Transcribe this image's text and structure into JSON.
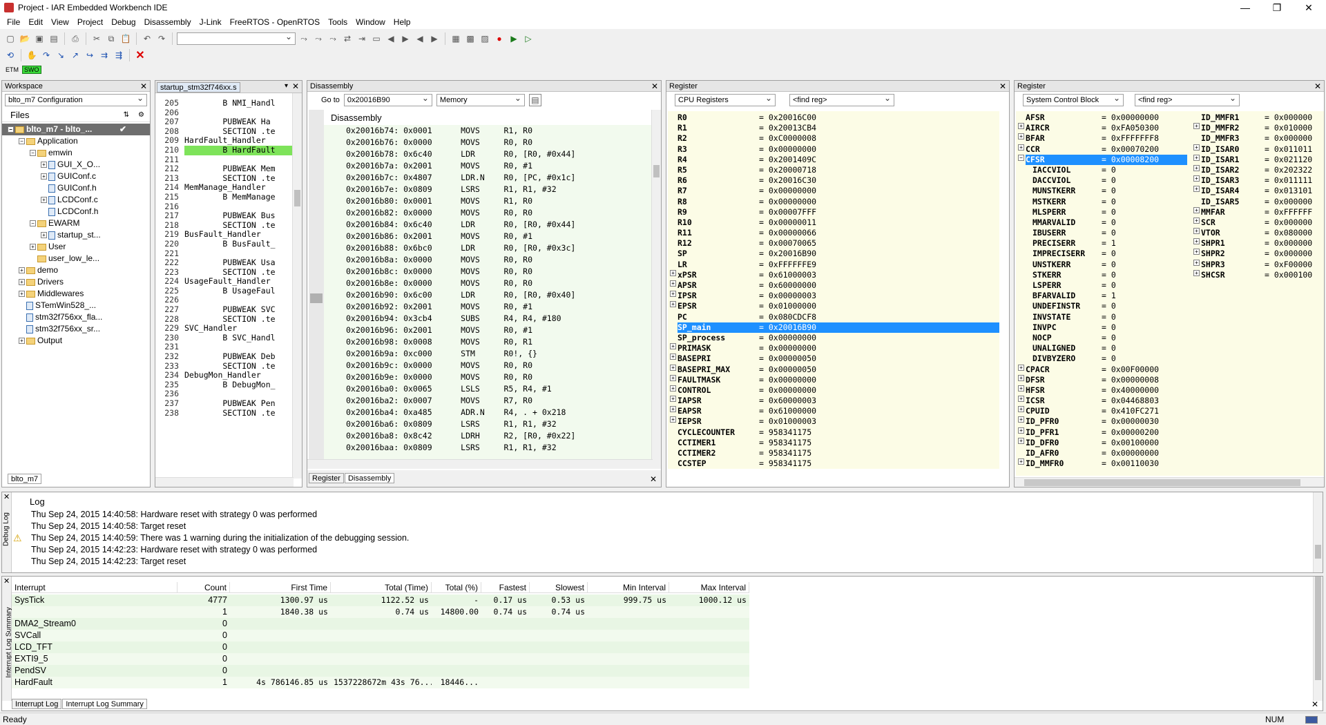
{
  "window": {
    "title": "Project - IAR Embedded Workbench IDE",
    "min": "—",
    "max": "❐",
    "close": "✕"
  },
  "menu": [
    "File",
    "Edit",
    "View",
    "Project",
    "Debug",
    "Disassembly",
    "J-Link",
    "FreeRTOS - OpenRTOS",
    "Tools",
    "Window",
    "Help"
  ],
  "toolbar3": {
    "etm": "ETM",
    "swo": "SWO"
  },
  "workspace": {
    "title": "Workspace",
    "config": "blto_m7 Configuration",
    "files_label": "Files",
    "tab": "blto_m7",
    "tree": [
      {
        "label": "blto_m7 - blto_...",
        "indent": 0,
        "type": "project",
        "exp": "−",
        "selected": true
      },
      {
        "label": "Application",
        "indent": 1,
        "type": "folder",
        "exp": "−"
      },
      {
        "label": "emwin",
        "indent": 2,
        "type": "folder",
        "exp": "−"
      },
      {
        "label": "GUI_X_O...",
        "indent": 3,
        "type": "file",
        "exp": "+"
      },
      {
        "label": "GUIConf.c",
        "indent": 3,
        "type": "file",
        "exp": "+"
      },
      {
        "label": "GUIConf.h",
        "indent": 3,
        "type": "file",
        "exp": ""
      },
      {
        "label": "LCDConf.c",
        "indent": 3,
        "type": "file",
        "exp": "+"
      },
      {
        "label": "LCDConf.h",
        "indent": 3,
        "type": "file",
        "exp": ""
      },
      {
        "label": "EWARM",
        "indent": 2,
        "type": "folder",
        "exp": "−"
      },
      {
        "label": "startup_st...",
        "indent": 3,
        "type": "file",
        "exp": "+"
      },
      {
        "label": "User",
        "indent": 2,
        "type": "folder",
        "exp": "+"
      },
      {
        "label": "user_low_le...",
        "indent": 2,
        "type": "folder",
        "exp": ""
      },
      {
        "label": "demo",
        "indent": 1,
        "type": "folder",
        "exp": "+"
      },
      {
        "label": "Drivers",
        "indent": 1,
        "type": "folder",
        "exp": "+"
      },
      {
        "label": "Middlewares",
        "indent": 1,
        "type": "folder",
        "exp": "+"
      },
      {
        "label": "STemWin528_...",
        "indent": 1,
        "type": "file",
        "exp": ""
      },
      {
        "label": "stm32f756xx_fla...",
        "indent": 1,
        "type": "file",
        "exp": ""
      },
      {
        "label": "stm32f756xx_sr...",
        "indent": 1,
        "type": "file",
        "exp": ""
      },
      {
        "label": "Output",
        "indent": 1,
        "type": "folder",
        "exp": "+"
      }
    ]
  },
  "editor": {
    "tab": "startup_stm32f746xx.s",
    "lines": [
      {
        "n": "205",
        "t": "        B NMI_Handl"
      },
      {
        "n": "206",
        "t": ""
      },
      {
        "n": "207",
        "t": "        PUBWEAK Ha"
      },
      {
        "n": "208",
        "t": "        SECTION .te"
      },
      {
        "n": "209",
        "t": "HardFault_Handler"
      },
      {
        "n": "210",
        "t": "        B HardFault",
        "hl": true
      },
      {
        "n": "211",
        "t": ""
      },
      {
        "n": "212",
        "t": "        PUBWEAK Mem"
      },
      {
        "n": "213",
        "t": "        SECTION .te"
      },
      {
        "n": "214",
        "t": "MemManage_Handler"
      },
      {
        "n": "215",
        "t": "        B MemManage"
      },
      {
        "n": "216",
        "t": ""
      },
      {
        "n": "217",
        "t": "        PUBWEAK Bus"
      },
      {
        "n": "218",
        "t": "        SECTION .te"
      },
      {
        "n": "219",
        "t": "BusFault_Handler"
      },
      {
        "n": "220",
        "t": "        B BusFault_"
      },
      {
        "n": "221",
        "t": ""
      },
      {
        "n": "222",
        "t": "        PUBWEAK Usa"
      },
      {
        "n": "223",
        "t": "        SECTION .te"
      },
      {
        "n": "224",
        "t": "UsageFault_Handler"
      },
      {
        "n": "225",
        "t": "        B UsageFaul"
      },
      {
        "n": "226",
        "t": ""
      },
      {
        "n": "227",
        "t": "        PUBWEAK SVC"
      },
      {
        "n": "228",
        "t": "        SECTION .te"
      },
      {
        "n": "229",
        "t": "SVC_Handler"
      },
      {
        "n": "230",
        "t": "        B SVC_Handl"
      },
      {
        "n": "231",
        "t": ""
      },
      {
        "n": "232",
        "t": "        PUBWEAK Deb"
      },
      {
        "n": "233",
        "t": "        SECTION .te"
      },
      {
        "n": "234",
        "t": "DebugMon_Handler"
      },
      {
        "n": "235",
        "t": "        B DebugMon_"
      },
      {
        "n": "236",
        "t": ""
      },
      {
        "n": "237",
        "t": "        PUBWEAK Pen"
      },
      {
        "n": "238",
        "t": "        SECTION .te"
      }
    ]
  },
  "disasm": {
    "title": "Disassembly",
    "goto_label": "Go to",
    "goto_value": "0x20016B90",
    "mode": "Memory",
    "inner_title": "Disassembly",
    "tabs": [
      "Register",
      "Disassembly"
    ],
    "lines": [
      "0x20016b74: 0x0001      MOVS     R1, R0",
      "0x20016b76: 0x0000      MOVS     R0, R0",
      "0x20016b78: 0x6c40      LDR      R0, [R0, #0x44]",
      "0x20016b7a: 0x2001      MOVS     R0, #1",
      "0x20016b7c: 0x4807      LDR.N    R0, [PC, #0x1c]",
      "0x20016b7e: 0x0809      LSRS     R1, R1, #32",
      "0x20016b80: 0x0001      MOVS     R1, R0",
      "0x20016b82: 0x0000      MOVS     R0, R0",
      "0x20016b84: 0x6c40      LDR      R0, [R0, #0x44]",
      "0x20016b86: 0x2001      MOVS     R0, #1",
      "0x20016b88: 0x6bc0      LDR      R0, [R0, #0x3c]",
      "0x20016b8a: 0x0000      MOVS     R0, R0",
      "0x20016b8c: 0x0000      MOVS     R0, R0",
      "0x20016b8e: 0x0000      MOVS     R0, R0",
      "0x20016b90: 0x6c00      LDR      R0, [R0, #0x40]",
      "0x20016b92: 0x2001      MOVS     R0, #1",
      "0x20016b94: 0x3cb4      SUBS     R4, R4, #180",
      "0x20016b96: 0x2001      MOVS     R0, #1",
      "0x20016b98: 0x0008      MOVS     R0, R1",
      "0x20016b9a: 0xc000      STM      R0!, {}",
      "0x20016b9c: 0x0000      MOVS     R0, R0",
      "0x20016b9e: 0x0000      MOVS     R0, R0",
      "0x20016ba0: 0x0065      LSLS     R5, R4, #1",
      "0x20016ba2: 0x0007      MOVS     R7, R0",
      "0x20016ba4: 0xa485      ADR.N    R4, . + 0x218",
      "0x20016ba6: 0x0809      LSRS     R1, R1, #32",
      "0x20016ba8: 0x8c42      LDRH     R2, [R0, #0x22]",
      "0x20016baa: 0x0809      LSRS     R1, R1, #32"
    ]
  },
  "reg1": {
    "title": "Register",
    "group": "CPU Registers",
    "find": "<find reg>",
    "rows": [
      {
        "e": "",
        "n": "R0",
        "v": "= 0x20016C00"
      },
      {
        "e": "",
        "n": "R1",
        "v": "= 0x20013CB4"
      },
      {
        "e": "",
        "n": "R2",
        "v": "= 0xC0000008"
      },
      {
        "e": "",
        "n": "R3",
        "v": "= 0x00000000"
      },
      {
        "e": "",
        "n": "R4",
        "v": "= 0x2001409C"
      },
      {
        "e": "",
        "n": "R5",
        "v": "= 0x20000718"
      },
      {
        "e": "",
        "n": "R6",
        "v": "= 0x20016C30"
      },
      {
        "e": "",
        "n": "R7",
        "v": "= 0x00000000"
      },
      {
        "e": "",
        "n": "R8",
        "v": "= 0x00000000"
      },
      {
        "e": "",
        "n": "R9",
        "v": "= 0x00007FFF"
      },
      {
        "e": "",
        "n": "R10",
        "v": "= 0x00000011"
      },
      {
        "e": "",
        "n": "R11",
        "v": "= 0x00000066"
      },
      {
        "e": "",
        "n": "R12",
        "v": "= 0x00070065"
      },
      {
        "e": "",
        "n": "SP",
        "v": "= 0x20016B90"
      },
      {
        "e": "",
        "n": "LR",
        "v": "= 0xFFFFFFE9"
      },
      {
        "e": "+",
        "n": "xPSR",
        "v": "= 0x61000003"
      },
      {
        "e": "+",
        "n": "APSR",
        "v": "= 0x60000000"
      },
      {
        "e": "+",
        "n": "IPSR",
        "v": "= 0x00000003"
      },
      {
        "e": "+",
        "n": "EPSR",
        "v": "= 0x01000000"
      },
      {
        "e": "",
        "n": "PC",
        "v": "= 0x080CDCF8"
      },
      {
        "e": "",
        "n": "SP_main",
        "v": "= 0x20016B90",
        "sel": true
      },
      {
        "e": "",
        "n": "SP_process",
        "v": "= 0x00000000"
      },
      {
        "e": "+",
        "n": "PRIMASK",
        "v": "= 0x00000000"
      },
      {
        "e": "+",
        "n": "BASEPRI",
        "v": "= 0x00000050"
      },
      {
        "e": "+",
        "n": "BASEPRI_MAX",
        "v": "= 0x00000050"
      },
      {
        "e": "+",
        "n": "FAULTMASK",
        "v": "= 0x00000000"
      },
      {
        "e": "+",
        "n": "CONTROL",
        "v": "= 0x00000000"
      },
      {
        "e": "+",
        "n": "IAPSR",
        "v": "= 0x60000003"
      },
      {
        "e": "+",
        "n": "EAPSR",
        "v": "= 0x61000000"
      },
      {
        "e": "+",
        "n": "IEPSR",
        "v": "= 0x01000003"
      },
      {
        "e": "",
        "n": "CYCLECOUNTER",
        "v": "= 958341175"
      },
      {
        "e": "",
        "n": "CCTIMER1",
        "v": "= 958341175"
      },
      {
        "e": "",
        "n": "CCTIMER2",
        "v": "= 958341175"
      },
      {
        "e": "",
        "n": "CCSTEP",
        "v": "= 958341175"
      }
    ]
  },
  "reg2": {
    "title": "Register",
    "group": "System Control Block",
    "find": "<find reg>",
    "left": [
      {
        "e": "",
        "n": "AFSR",
        "v": "= 0x00000000"
      },
      {
        "e": "+",
        "n": "AIRCR",
        "v": "= 0xFA050300"
      },
      {
        "e": "+",
        "n": "BFAR",
        "v": "= 0xFFFFFFF8"
      },
      {
        "e": "+",
        "n": "CCR",
        "v": "= 0x00070200"
      },
      {
        "e": "−",
        "n": "CFSR",
        "v": "= 0x00008200",
        "sel": true
      },
      {
        "e": "",
        "n": "IACCVIOL",
        "v": "= 0",
        "sub": true
      },
      {
        "e": "",
        "n": "DACCVIOL",
        "v": "= 0",
        "sub": true
      },
      {
        "e": "",
        "n": "MUNSTKERR",
        "v": "= 0",
        "sub": true
      },
      {
        "e": "",
        "n": "MSTKERR",
        "v": "= 0",
        "sub": true
      },
      {
        "e": "",
        "n": "MLSPERR",
        "v": "= 0",
        "sub": true
      },
      {
        "e": "",
        "n": "MMARVALID",
        "v": "= 0",
        "sub": true
      },
      {
        "e": "",
        "n": "IBUSERR",
        "v": "= 0",
        "sub": true
      },
      {
        "e": "",
        "n": "PRECISERR",
        "v": "= 1",
        "sub": true
      },
      {
        "e": "",
        "n": "IMPRECISERR",
        "v": "= 0",
        "sub": true
      },
      {
        "e": "",
        "n": "UNSTKERR",
        "v": "= 0",
        "sub": true
      },
      {
        "e": "",
        "n": "STKERR",
        "v": "= 0",
        "sub": true
      },
      {
        "e": "",
        "n": "LSPERR",
        "v": "= 0",
        "sub": true
      },
      {
        "e": "",
        "n": "BFARVALID",
        "v": "= 1",
        "sub": true
      },
      {
        "e": "",
        "n": "UNDEFINSTR",
        "v": "= 0",
        "sub": true
      },
      {
        "e": "",
        "n": "INVSTATE",
        "v": "= 0",
        "sub": true
      },
      {
        "e": "",
        "n": "INVPC",
        "v": "= 0",
        "sub": true
      },
      {
        "e": "",
        "n": "NOCP",
        "v": "= 0",
        "sub": true
      },
      {
        "e": "",
        "n": "UNALIGNED",
        "v": "= 0",
        "sub": true
      },
      {
        "e": "",
        "n": "DIVBYZERO",
        "v": "= 0",
        "sub": true
      },
      {
        "e": "+",
        "n": "CPACR",
        "v": "= 0x00F00000"
      },
      {
        "e": "+",
        "n": "DFSR",
        "v": "= 0x00000008"
      },
      {
        "e": "+",
        "n": "HFSR",
        "v": "= 0x40000000"
      },
      {
        "e": "+",
        "n": "ICSR",
        "v": "= 0x04468803"
      },
      {
        "e": "+",
        "n": "CPUID",
        "v": "= 0x410FC271"
      },
      {
        "e": "+",
        "n": "ID_PFR0",
        "v": "= 0x00000030"
      },
      {
        "e": "+",
        "n": "ID_PFR1",
        "v": "= 0x00000200"
      },
      {
        "e": "+",
        "n": "ID_DFR0",
        "v": "= 0x00100000"
      },
      {
        "e": "",
        "n": "ID_AFR0",
        "v": "= 0x00000000"
      },
      {
        "e": "+",
        "n": "ID_MMFR0",
        "v": "= 0x00110030"
      }
    ],
    "right": [
      {
        "e": "",
        "n": "ID_MMFR1",
        "v": "= 0x000000"
      },
      {
        "e": "+",
        "n": "ID_MMFR2",
        "v": "= 0x010000"
      },
      {
        "e": "",
        "n": "ID_MMFR3",
        "v": "= 0x000000"
      },
      {
        "e": "+",
        "n": "ID_ISAR0",
        "v": "= 0x011011"
      },
      {
        "e": "+",
        "n": "ID_ISAR1",
        "v": "= 0x021120"
      },
      {
        "e": "+",
        "n": "ID_ISAR2",
        "v": "= 0x202322"
      },
      {
        "e": "+",
        "n": "ID_ISAR3",
        "v": "= 0x011111"
      },
      {
        "e": "+",
        "n": "ID_ISAR4",
        "v": "= 0x013101"
      },
      {
        "e": "",
        "n": "ID_ISAR5",
        "v": "= 0x000000"
      },
      {
        "e": "+",
        "n": "MMFAR",
        "v": "= 0xFFFFFF"
      },
      {
        "e": "+",
        "n": "SCR",
        "v": "= 0x000000"
      },
      {
        "e": "+",
        "n": "VTOR",
        "v": "= 0x080000"
      },
      {
        "e": "+",
        "n": "SHPR1",
        "v": "= 0x000000"
      },
      {
        "e": "+",
        "n": "SHPR2",
        "v": "= 0x000000"
      },
      {
        "e": "+",
        "n": "SHPR3",
        "v": "= 0xF00000"
      },
      {
        "e": "+",
        "n": "SHCSR",
        "v": "= 0x000100"
      }
    ]
  },
  "log": {
    "side": "Debug Log",
    "header": "Log",
    "lines": [
      {
        "w": false,
        "t": "Thu Sep 24, 2015 14:40:58: Hardware reset with strategy 0 was performed"
      },
      {
        "w": false,
        "t": "Thu Sep 24, 2015 14:40:58: Target reset"
      },
      {
        "w": true,
        "t": "Thu Sep 24, 2015 14:40:59: There was 1 warning during the initialization of the debugging session."
      },
      {
        "w": false,
        "t": "Thu Sep 24, 2015 14:42:23: Hardware reset with strategy 0 was performed"
      },
      {
        "w": false,
        "t": "Thu Sep 24, 2015 14:42:23: Target reset"
      }
    ]
  },
  "ilog": {
    "side": "Interrupt Log Summary",
    "tabs": [
      "Interrupt Log",
      "Interrupt Log Summary"
    ],
    "headers": [
      "Interrupt",
      "Count",
      "First Time",
      "Total (Time)",
      "Total (%)",
      "Fastest",
      "Slowest",
      "Min Interval",
      "Max Interval"
    ],
    "rows": [
      [
        "SysTick",
        "4777",
        "1300.97 us",
        "1122.52 us",
        "-",
        "0.17 us",
        "0.53 us",
        "999.75 us",
        "1000.12 us"
      ],
      [
        "",
        "1",
        "1840.38 us",
        "0.74 us",
        "14800.00",
        "0.74 us",
        "0.74 us",
        "",
        ""
      ],
      [
        "DMA2_Stream0",
        "0",
        "",
        "",
        "",
        "",
        "",
        "",
        ""
      ],
      [
        "SVCall",
        "0",
        "",
        "",
        "",
        "",
        "",
        "",
        ""
      ],
      [
        "LCD_TFT",
        "0",
        "",
        "",
        "",
        "",
        "",
        "",
        ""
      ],
      [
        "EXTI9_5",
        "0",
        "",
        "",
        "",
        "",
        "",
        "",
        ""
      ],
      [
        "PendSV",
        "0",
        "",
        "",
        "",
        "",
        "",
        "",
        ""
      ],
      [
        "HardFault",
        "1",
        "4s 786146.85 us",
        "1537228672m 43s 76...",
        "18446...",
        "",
        "",
        "",
        ""
      ]
    ]
  },
  "status": {
    "left": "Ready",
    "num": "NUM"
  }
}
